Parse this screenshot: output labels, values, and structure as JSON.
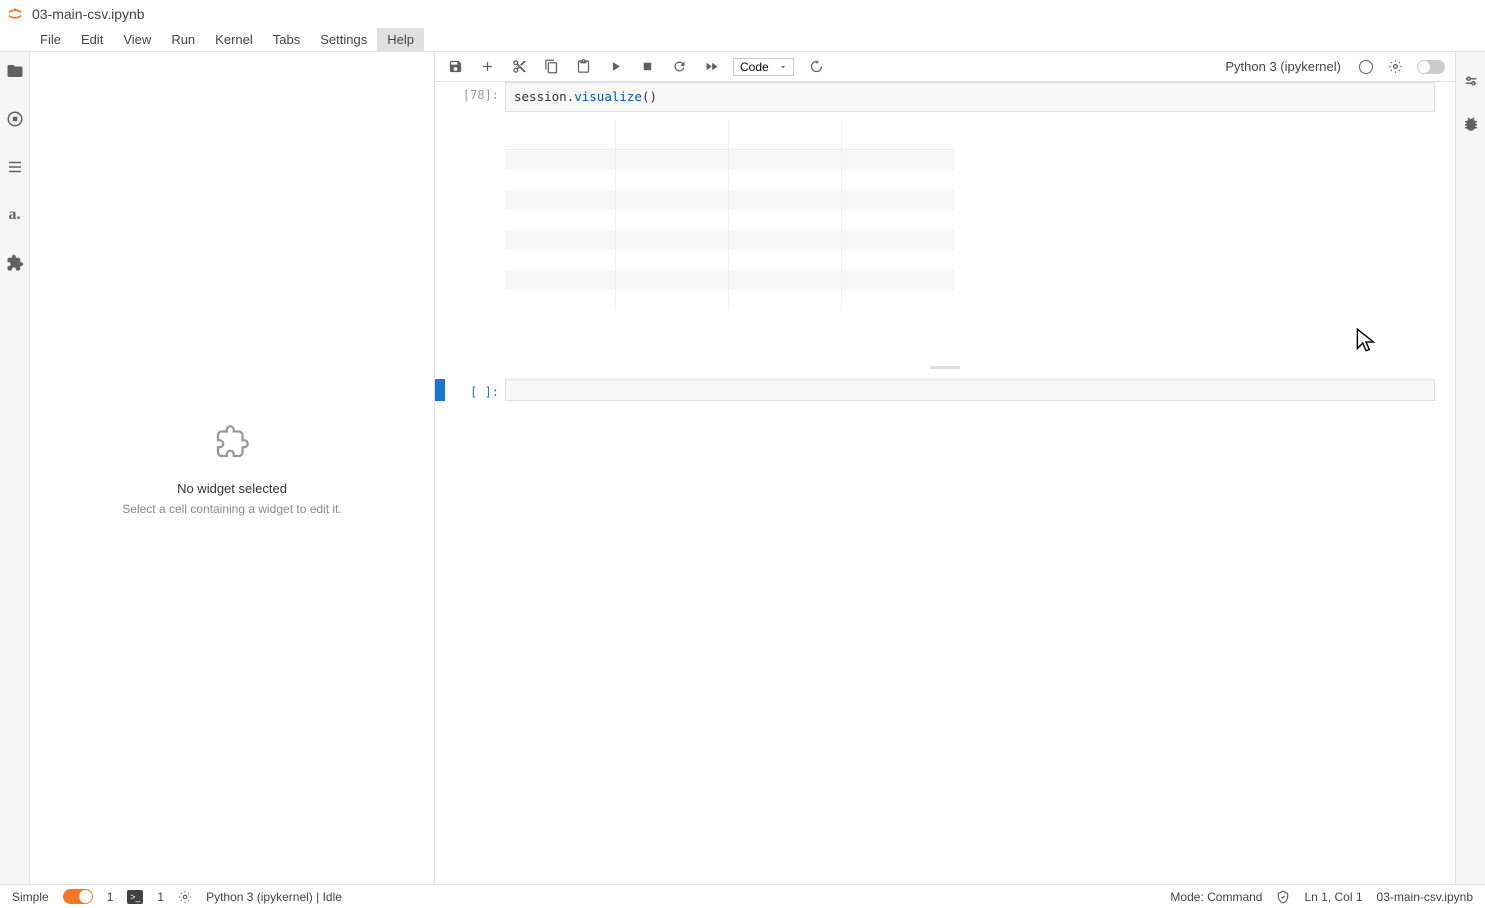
{
  "title": "03-main-csv.ipynb",
  "menu": [
    "File",
    "Edit",
    "View",
    "Run",
    "Kernel",
    "Tabs",
    "Settings",
    "Help"
  ],
  "menu_active": "Help",
  "toolbar": {
    "cell_type": "Code",
    "kernel_display": "Python 3 (ipykernel)"
  },
  "cells": [
    {
      "exec_count": "[78]:",
      "source_obj": "session",
      "source_method": "visualize",
      "source_paren": "()"
    },
    {
      "exec_count": "[ ]:",
      "source": ""
    }
  ],
  "widget_panel": {
    "title": "No widget selected",
    "subtitle": "Select a cell containing a widget to edit it."
  },
  "statusbar": {
    "simple_label": "Simple",
    "terminals": "1",
    "kernels": "1",
    "kernel_status": "Python 3 (ipykernel) | Idle",
    "mode": "Mode: Command",
    "cursor": "Ln 1, Col 1",
    "file": "03-main-csv.ipynb"
  }
}
